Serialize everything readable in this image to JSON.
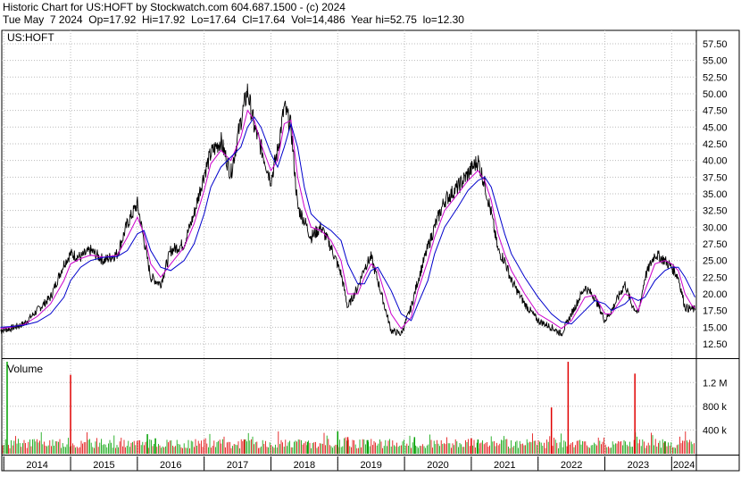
{
  "header": {
    "line1": "Historic Chart for US:HOFT by Stockwatch.com 604.687.1500 - (c) 2024",
    "line2": "Tue May  7 2024  Op=17.92  Hi=17.92  Lo=17.64  Cl=17.64  Vol=14,486  Year hi=52.75  lo=12.30"
  },
  "chart_data": [
    {
      "type": "line",
      "title": "US:HOFT",
      "price_ticks": [
        "57.50",
        "55.00",
        "52.50",
        "50.00",
        "47.50",
        "45.00",
        "42.50",
        "40.00",
        "37.50",
        "35.00",
        "32.50",
        "30.00",
        "27.50",
        "25.00",
        "22.50",
        "20.00",
        "17.50",
        "15.00",
        "12.50"
      ],
      "ylim": [
        10.5,
        59.5
      ],
      "x": [
        2013.95,
        2014.1,
        2014.3,
        2014.5,
        2014.7,
        2014.9,
        2015.0,
        2015.15,
        2015.3,
        2015.5,
        2015.7,
        2015.85,
        2016.0,
        2016.1,
        2016.2,
        2016.35,
        2016.5,
        2016.7,
        2016.85,
        2017.0,
        2017.1,
        2017.25,
        2017.4,
        2017.55,
        2017.65,
        2017.75,
        2017.85,
        2018.0,
        2018.1,
        2018.2,
        2018.3,
        2018.4,
        2018.5,
        2018.6,
        2018.75,
        2018.9,
        2019.05,
        2019.15,
        2019.3,
        2019.4,
        2019.5,
        2019.6,
        2019.8,
        2019.95,
        2020.1,
        2020.2,
        2020.35,
        2020.45,
        2020.6,
        2020.8,
        2020.95,
        2021.1,
        2021.2,
        2021.3,
        2021.4,
        2021.5,
        2021.6,
        2021.8,
        2022.0,
        2022.2,
        2022.35,
        2022.5,
        2022.7,
        2022.85,
        2023.0,
        2023.1,
        2023.3,
        2023.4,
        2023.5,
        2023.6,
        2023.75,
        2023.9,
        2024.0,
        2024.1,
        2024.2,
        2024.3,
        2024.35
      ],
      "series": [
        {
          "values": [
            14.5,
            14.8,
            15.5,
            17.5,
            19.5,
            24.5,
            26.0,
            25.5,
            26.5,
            25.0,
            26.0,
            30.5,
            33.5,
            28.0,
            22.5,
            21.5,
            26.5,
            27.5,
            32.0,
            38.0,
            41.0,
            43.0,
            38.0,
            46.0,
            50.5,
            45.0,
            42.0,
            37.0,
            41.5,
            48.0,
            45.0,
            33.0,
            31.0,
            28.5,
            30.0,
            27.0,
            23.0,
            18.0,
            21.0,
            24.0,
            25.5,
            22.0,
            14.5,
            14.0,
            18.0,
            22.0,
            27.0,
            30.0,
            34.0,
            36.0,
            38.0,
            40.0,
            36.5,
            32.0,
            26.5,
            25.0,
            22.0,
            18.5,
            16.0,
            15.0,
            14.0,
            17.0,
            21.0,
            19.5,
            16.0,
            17.5,
            21.5,
            18.5,
            17.0,
            22.5,
            26.0,
            25.0,
            24.0,
            22.5,
            18.0,
            17.7,
            17.64
          ]
        },
        {
          "values": [
            14.8,
            15.0,
            15.4,
            16.6,
            18.5,
            22.0,
            24.5,
            25.3,
            25.8,
            25.5,
            25.8,
            28.5,
            31.5,
            29.0,
            24.5,
            22.5,
            24.5,
            27.0,
            30.5,
            35.5,
            39.5,
            41.5,
            40.0,
            43.5,
            47.5,
            46.0,
            42.5,
            38.5,
            40.0,
            45.5,
            46.0,
            37.5,
            33.0,
            30.0,
            29.5,
            28.0,
            25.0,
            20.0,
            20.0,
            22.5,
            24.5,
            23.5,
            17.0,
            14.8,
            16.5,
            20.5,
            25.0,
            28.5,
            32.5,
            35.0,
            37.0,
            38.5,
            37.0,
            34.0,
            29.0,
            26.0,
            23.5,
            20.0,
            17.0,
            15.8,
            14.8,
            16.0,
            19.5,
            19.8,
            17.0,
            17.0,
            20.0,
            19.5,
            17.5,
            20.5,
            24.5,
            25.0,
            24.5,
            23.5,
            20.0,
            18.3,
            17.9
          ]
        },
        {
          "values": [
            15.0,
            15.1,
            15.3,
            15.8,
            17.0,
            19.5,
            22.0,
            24.0,
            25.0,
            25.5,
            25.6,
            26.5,
            29.0,
            29.5,
            26.5,
            24.0,
            23.5,
            25.0,
            27.5,
            32.0,
            36.0,
            39.0,
            40.5,
            42.0,
            45.0,
            46.5,
            45.0,
            41.0,
            39.0,
            42.0,
            45.5,
            42.0,
            36.0,
            32.0,
            30.5,
            29.5,
            28.0,
            24.5,
            21.5,
            21.5,
            23.5,
            24.0,
            20.5,
            17.0,
            16.0,
            18.5,
            22.0,
            26.0,
            30.0,
            33.0,
            35.5,
            37.0,
            37.5,
            36.0,
            32.5,
            29.0,
            26.0,
            22.5,
            19.5,
            17.0,
            15.8,
            15.5,
            17.5,
            19.0,
            18.5,
            17.5,
            18.5,
            19.5,
            19.0,
            19.5,
            22.0,
            23.5,
            24.0,
            24.0,
            22.5,
            20.5,
            19.5
          ]
        }
      ]
    },
    {
      "type": "bar",
      "title": "Volume",
      "volume_ticks": [
        "1.2 M",
        "800 k",
        "400 k"
      ],
      "ylim": [
        0,
        1550000
      ],
      "x_ticks": [
        "2014",
        "2015",
        "2016",
        "2017",
        "2018",
        "2019",
        "2020",
        "2021",
        "2022",
        "2023",
        "2024"
      ],
      "x": [
        2014.05,
        2015.0,
        2016.15,
        2016.27,
        2017.6,
        2018.55,
        2019.0,
        2019.15,
        2019.45,
        2020.15,
        2021.0,
        2021.1,
        2022.2,
        2022.45,
        2023.45,
        2023.9
      ],
      "values": [
        1550000,
        1330000,
        330000,
        260000,
        240000,
        200000,
        380000,
        280000,
        230000,
        280000,
        260000,
        240000,
        780000,
        1550000,
        1350000,
        210000
      ],
      "colors": {
        "up": "#00a000",
        "down": "#e00000"
      }
    }
  ],
  "colors": {
    "price": "#000000",
    "ma_short": "#cc00cc",
    "ma_long": "#0000cc",
    "grid": "#bbbbbb"
  }
}
